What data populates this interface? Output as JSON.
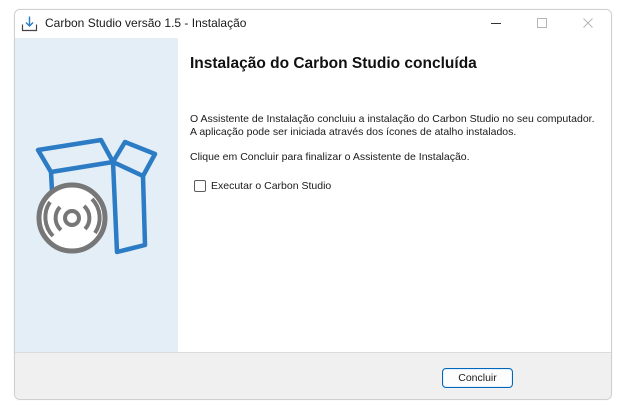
{
  "window": {
    "title": "Carbon Studio versão 1.5 - Instalação",
    "icon": "installer-icon",
    "controls": {
      "minimize": "minimize-icon",
      "maximize": "maximize-icon",
      "close": "close-icon"
    }
  },
  "side_panel": {
    "illustration": "software-box-cd-icon"
  },
  "main": {
    "heading": "Instalação do Carbon Studio concluída",
    "paragraph1": "O Assistente de Instalação concluiu a instalação do Carbon Studio no seu computador. A aplicação pode ser iniciada através dos ícones de atalho instalados.",
    "paragraph2": "Clique em Concluir para finalizar o Assistente de Instalação.",
    "run_checkbox": {
      "label": "Executar o Carbon Studio",
      "checked": false
    }
  },
  "footer": {
    "finish_button": "Concluir"
  },
  "colors": {
    "accent": "#0067c0",
    "side_panel_bg": "#e3eef7",
    "box_blue": "#2b7cc4",
    "disc_gray": "#777777"
  }
}
